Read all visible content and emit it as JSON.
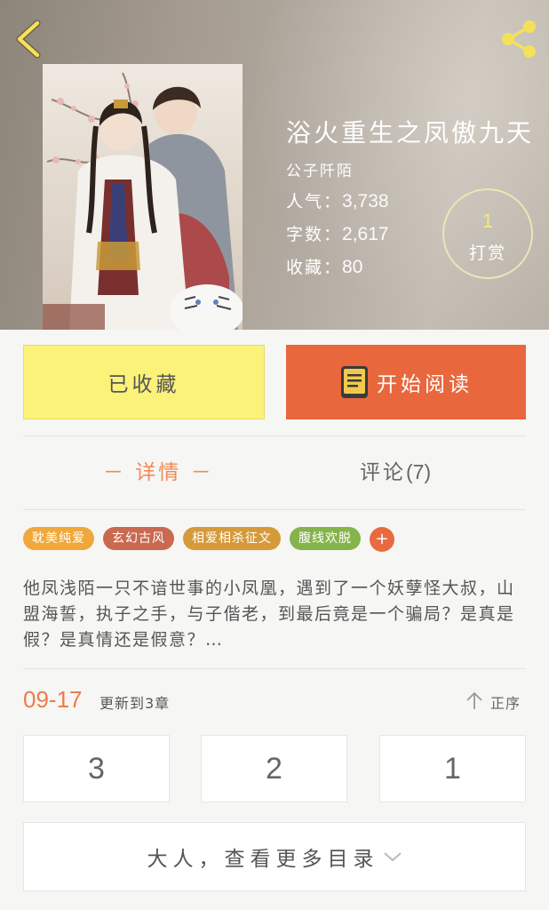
{
  "book": {
    "title": "浴火重生之凤傲九天",
    "author": "公子阡陌",
    "stats": {
      "popularity_label": "人气：",
      "popularity": "3,738",
      "words_label": "字数：",
      "words": "2,617",
      "favorites_label": "收藏：",
      "favorites": "80"
    },
    "reward": {
      "count": "1",
      "label": "打赏"
    }
  },
  "actions": {
    "favorited_label": "已收藏",
    "read_label": "开始阅读"
  },
  "tabs": {
    "detail": "－ 详情 －",
    "comments_label": "评论",
    "comments_count": "(7)"
  },
  "tags": [
    {
      "label": "耽美纯爱",
      "color": "#f0a83a"
    },
    {
      "label": "玄幻古风",
      "color": "#c9694f"
    },
    {
      "label": "相爱相杀征文",
      "color": "#d59a3a"
    },
    {
      "label": "腹线欢脱",
      "color": "#86b44c"
    }
  ],
  "tag_add": "+",
  "description": "他凤浅陌一只不谙世事的小凤凰，遇到了一个妖孽怪大叔，山盟海誓，执子之手，与子偕老，到最后竟是一个骗局？是真是假？是真情还是假意？…",
  "update": {
    "date": "09-17",
    "text": "更新到3章",
    "sort_label": "正序"
  },
  "chapters": [
    "3",
    "2",
    "1"
  ],
  "more_catalog": "大人，查看更多目录",
  "icons": {
    "back": "chevron-left-icon",
    "share": "share-icon",
    "book": "book-icon",
    "sort": "arrow-up-icon",
    "more": "chevron-down-icon"
  },
  "colors": {
    "accent_orange": "#e8673d",
    "fav_yellow": "#fbf27a",
    "icon_yellow": "#f5e05a",
    "tab_active": "#ef8b59"
  }
}
